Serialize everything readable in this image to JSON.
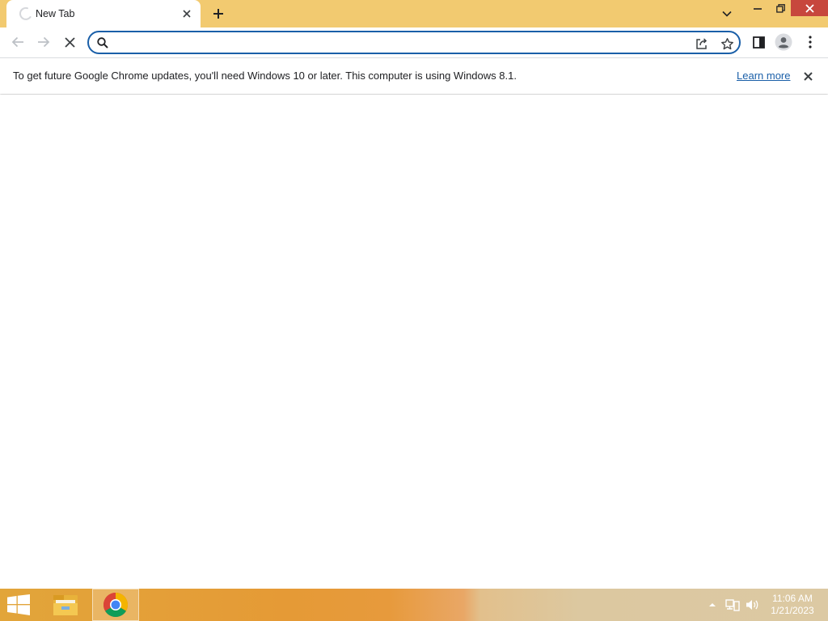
{
  "browser": {
    "tab": {
      "title": "New Tab",
      "close_icon": "close-icon"
    },
    "omnibox": {
      "value": "",
      "placeholder": ""
    }
  },
  "infobar": {
    "message": "To get future Google Chrome updates, you'll need Windows 10 or later. This computer is using Windows 8.1.",
    "link": "Learn more"
  },
  "taskbar": {
    "apps": [
      "File Explorer",
      "Google Chrome"
    ],
    "clock": {
      "time": "11:06 AM",
      "date": "1/21/2023"
    }
  },
  "colors": {
    "tabstrip": "#f2ca70",
    "omnibox_border": "#1a5fa8",
    "close_button": "#c7473d",
    "link": "#1a5fa8"
  }
}
